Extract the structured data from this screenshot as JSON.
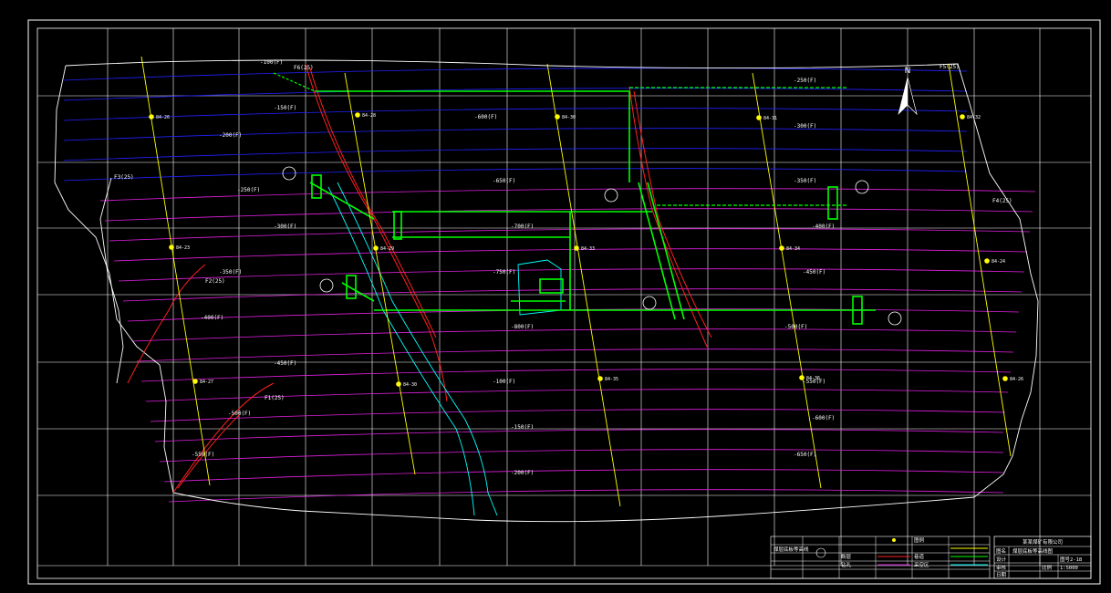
{
  "colors": {
    "background": "#000000",
    "frame": "#ffffff",
    "grid": "#ffffff",
    "contour_blue": "#2222ff",
    "contour_magenta": "#e020e0",
    "borehole_line": "#ffff00",
    "borehole_dot": "#ffff00",
    "fault": "#ff2020",
    "roadway": "#00ff00",
    "goaf_boundary": "#00ffff"
  },
  "north_label": "N",
  "boreholes": [
    {
      "label": "84-26",
      "tone": "bh"
    },
    {
      "label": "84-28",
      "tone": "bh"
    },
    {
      "label": "84-30",
      "tone": "bh"
    },
    {
      "label": "84-31",
      "tone": "bh"
    },
    {
      "label": "84-32",
      "tone": "bh"
    },
    {
      "label": "84-23",
      "tone": "bh"
    },
    {
      "label": "84-29",
      "tone": "bh"
    },
    {
      "label": "84-33",
      "tone": "bh"
    },
    {
      "label": "84-34",
      "tone": "bh"
    },
    {
      "label": "84-24",
      "tone": "bh"
    },
    {
      "label": "84-27",
      "tone": "bh"
    },
    {
      "label": "84-30",
      "tone": "bh"
    },
    {
      "label": "84-35",
      "tone": "bh"
    },
    {
      "label": "84-36",
      "tone": "bh"
    }
  ],
  "fault_labels": [
    "F6(25)",
    "F5(25)",
    "F4(25)",
    "F3(25)",
    "F2(25)",
    "F1(25)"
  ],
  "contour_labels": [
    "-100(F)",
    "-150(F)",
    "-200(F)",
    "-250(F)",
    "-300(F)",
    "-350(F)",
    "-400(F)",
    "-450(F)",
    "-500(F)",
    "-550(F)",
    "-600(F)",
    "-650(F)",
    "-700(F)",
    "-750(F)",
    "-800(F)"
  ],
  "legend": {
    "items": [
      "煤层底板等高线",
      "断层",
      "钻孔",
      "巷道",
      "采空区",
      "图例"
    ]
  },
  "title_block": {
    "company": "某某煤矿有限公司",
    "drawing_title": "煤层底板等高线图",
    "drawing_no": "图号2-18",
    "scale_label": "比例",
    "scale": "1:5000",
    "row_labels": [
      "图名",
      "设计",
      "审核",
      "日期"
    ]
  }
}
